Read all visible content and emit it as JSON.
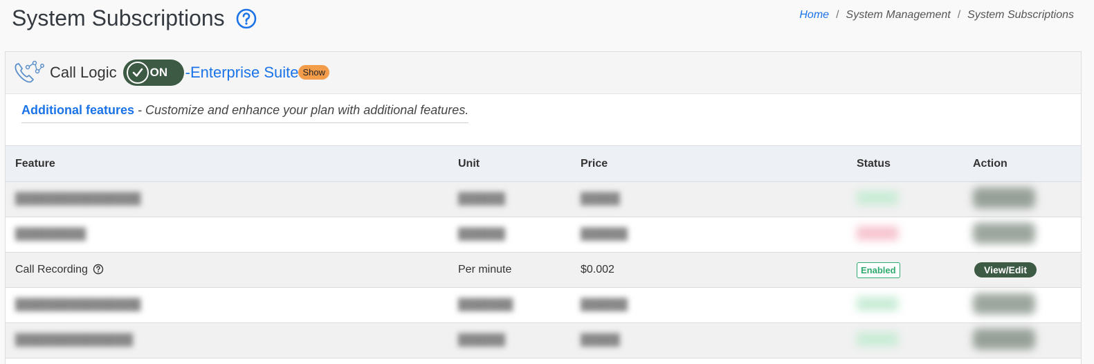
{
  "page": {
    "title": "System Subscriptions",
    "help_icon": "question-circle-icon"
  },
  "breadcrumb": {
    "home": "Home",
    "sep1": "/",
    "mgmt": "System Management",
    "sep2": "/",
    "current": "System Subscriptions"
  },
  "subscription": {
    "icon": "phone-network-icon",
    "product": "Call Logic",
    "toggle_state": "ON",
    "dash": "-",
    "plan": "Enterprise Suite",
    "show_label": "Show"
  },
  "features": {
    "title": "Additional features",
    "description": " - Customize and enhance your plan with additional features."
  },
  "table": {
    "headers": {
      "feature": "Feature",
      "unit": "Unit",
      "price": "Price",
      "status": "Status",
      "action": "Action"
    },
    "visible_row": {
      "feature": "Call Recording",
      "unit": "Per minute",
      "price": "$0.002",
      "status": "Enabled",
      "action": "View/Edit"
    }
  },
  "colors": {
    "accent": "#1a73e8",
    "toggle_bg": "#3c5a44",
    "show_badge": "#f39c4a",
    "enabled": "#2eaa6d"
  }
}
